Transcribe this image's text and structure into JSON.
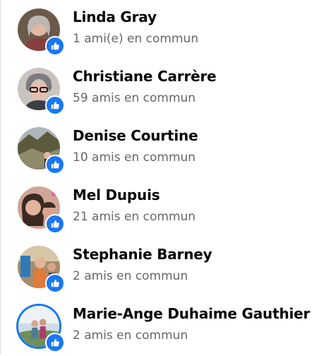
{
  "friends": [
    {
      "name": "Linda Gray",
      "mutual": "1 ami(e) en commun",
      "avatar_tone": "#8a3d3d",
      "avatar_bg": "#6b5a4a",
      "ring": false
    },
    {
      "name": "Christiane Carrère",
      "mutual": "59 amis en commun",
      "avatar_tone": "#7d7b82",
      "avatar_bg": "#c9c4bf",
      "ring": false
    },
    {
      "name": "Denise Courtine",
      "mutual": "10 amis en commun",
      "avatar_tone": "#5c5a3e",
      "avatar_bg": "#8f8b6a",
      "ring": false
    },
    {
      "name": "Mel Dupuis",
      "mutual": "21 amis en commun",
      "avatar_tone": "#9a6a58",
      "avatar_bg": "#cfa595",
      "ring": false
    },
    {
      "name": "Stephanie Barney",
      "mutual": "2 amis en commun",
      "avatar_tone": "#4d6a86",
      "avatar_bg": "#a88b6a",
      "ring": false
    },
    {
      "name": "Marie-Ange Duhaime Gauthier",
      "mutual": "2 amis en commun",
      "avatar_tone": "#4f7a9a",
      "avatar_bg": "#cfdbe6",
      "ring": true
    }
  ],
  "badge_color": "#1877f2",
  "badge_icon": "thumbs-up-icon"
}
